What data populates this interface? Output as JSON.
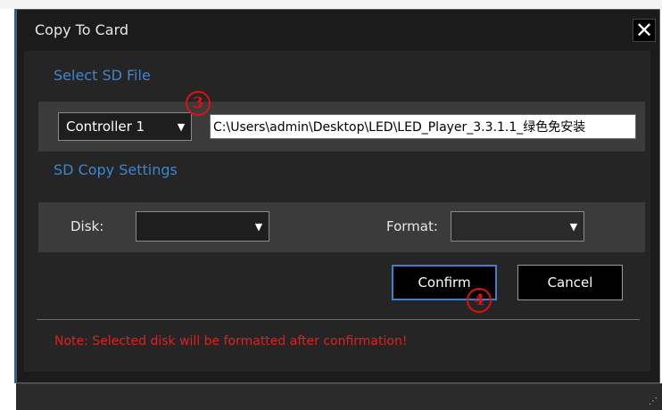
{
  "dialog": {
    "title": "Copy To Card",
    "close_glyph": "✕"
  },
  "select_sd": {
    "section_label": "Select SD File",
    "controller_value": "Controller 1",
    "path_value": "C:\\Users\\admin\\Desktop\\LED\\LED_Player_3.3.1.1_绿色免安装"
  },
  "copy_settings": {
    "section_label": "SD Copy Settings",
    "disk_label": "Disk:",
    "disk_value": "",
    "format_label": "Format:",
    "format_value": ""
  },
  "buttons": {
    "confirm": "Confirm",
    "cancel": "Cancel"
  },
  "note": "Note: Selected disk will be formatted after confirmation!",
  "markers": {
    "step3": "3",
    "step4": "4"
  },
  "colors": {
    "accent": "#3a86d6",
    "warning": "#e02020",
    "marker": "#e01010"
  }
}
